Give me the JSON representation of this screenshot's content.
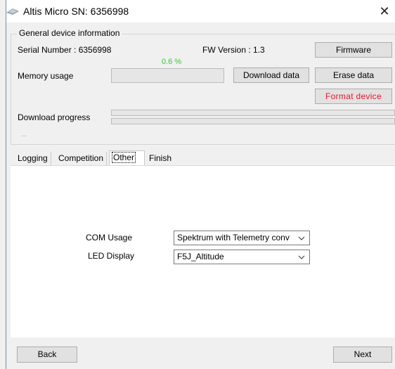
{
  "window": {
    "title": "Altis Micro  SN: 6356998",
    "close_icon": "close-icon"
  },
  "general": {
    "group_title": "General device information",
    "serial_label": "Serial Number : 6356998",
    "fw_label": "FW Version : 1.3",
    "firmware_button": "Firmware",
    "memory_label": "Memory usage",
    "memory_percent_text": "0.6 %",
    "memory_fraction": 0.006,
    "download_data_button": "Download data",
    "erase_data_button": "Erase data",
    "format_device_button": "Format device",
    "download_progress_label": "Download progress",
    "download_progress_fraction": 0,
    "status_text": "..."
  },
  "tabs": [
    {
      "label": "Logging"
    },
    {
      "label": "Competition"
    },
    {
      "label": "Other"
    },
    {
      "label": "Finish"
    }
  ],
  "other": {
    "com_usage_label": "COM Usage",
    "com_usage_value": "Spektrum with Telemetry conv",
    "led_display_label": "LED Display",
    "led_display_value": "F5J_Altitude"
  },
  "footer": {
    "back_button": "Back",
    "next_button": "Next"
  },
  "colors": {
    "percent_text": "#2ad12a",
    "format_button_text": "#e8142c"
  }
}
